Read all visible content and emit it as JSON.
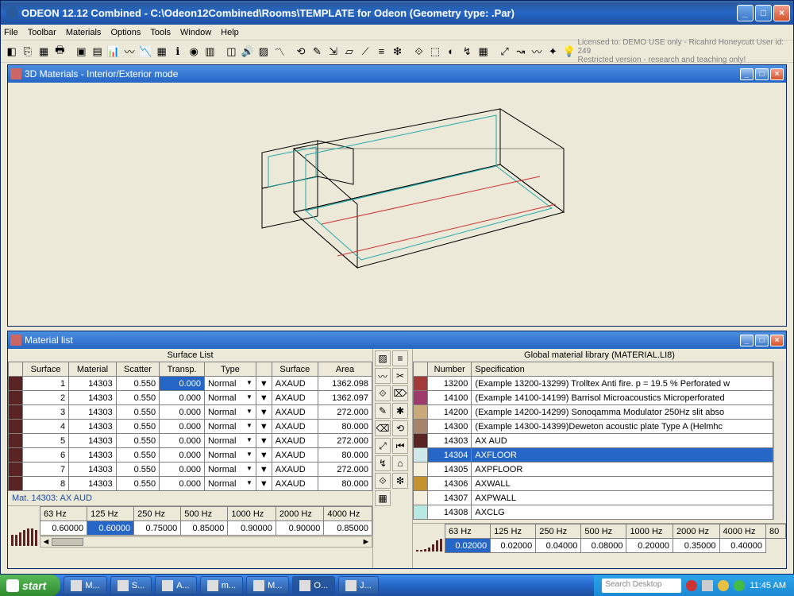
{
  "app": {
    "title": "ODEON 12.12 Combined  -  C:\\Odeon12Combined\\Rooms\\TEMPLATE for Odeon      (Geometry type: .Par)",
    "license1": "Licensed to: DEMO USE only - Ricahrd Honeycutt   User id: 249",
    "license2": "Restricted version - research and teaching only!"
  },
  "menu": [
    "File",
    "Toolbar",
    "Materials",
    "Options",
    "Tools",
    "Window",
    "Help"
  ],
  "win3d": {
    "title": "3D Materials - Interior/Exterior mode"
  },
  "winlist": {
    "title": "Material list"
  },
  "surface_list": {
    "title": "Surface List",
    "headers": [
      "",
      "Surface",
      "Material",
      "Scatter",
      "Transp.",
      "Type",
      "",
      "Surface",
      "Area"
    ],
    "rows": [
      {
        "n": "1",
        "mat": "14303",
        "sc": "0.550",
        "tr": "0.000",
        "type": "Normal",
        "surf": "AXAUD",
        "area": "1362.098",
        "sel": true
      },
      {
        "n": "2",
        "mat": "14303",
        "sc": "0.550",
        "tr": "0.000",
        "type": "Normal",
        "surf": "AXAUD",
        "area": "1362.097"
      },
      {
        "n": "3",
        "mat": "14303",
        "sc": "0.550",
        "tr": "0.000",
        "type": "Normal",
        "surf": "AXAUD",
        "area": "272.000"
      },
      {
        "n": "4",
        "mat": "14303",
        "sc": "0.550",
        "tr": "0.000",
        "type": "Normal",
        "surf": "AXAUD",
        "area": "80.000"
      },
      {
        "n": "5",
        "mat": "14303",
        "sc": "0.550",
        "tr": "0.000",
        "type": "Normal",
        "surf": "AXAUD",
        "area": "272.000"
      },
      {
        "n": "6",
        "mat": "14303",
        "sc": "0.550",
        "tr": "0.000",
        "type": "Normal",
        "surf": "AXAUD",
        "area": "80.000"
      },
      {
        "n": "7",
        "mat": "14303",
        "sc": "0.550",
        "tr": "0.000",
        "type": "Normal",
        "surf": "AXAUD",
        "area": "272.000"
      },
      {
        "n": "8",
        "mat": "14303",
        "sc": "0.550",
        "tr": "0.000",
        "type": "Normal",
        "surf": "AXAUD",
        "area": "80.000"
      }
    ]
  },
  "mat_label": "Mat. 14303: AX AUD",
  "freq": {
    "headers": [
      "63 Hz",
      "125 Hz",
      "250 Hz",
      "500 Hz",
      "1000 Hz",
      "2000 Hz",
      "4000 Hz"
    ],
    "values": [
      "0.60000",
      "0.60000",
      "0.75000",
      "0.85000",
      "0.90000",
      "0.90000",
      "0.85000"
    ]
  },
  "library": {
    "title": "Global material library (MATERIAL.LI8)",
    "headers": [
      "",
      "Number",
      "Specification"
    ],
    "rows": [
      {
        "c": "#a23a3a",
        "n": "13200",
        "s": "(Example 13200-13299) Trolltex Anti fire. p = 19.5 % Perforated w"
      },
      {
        "c": "#a03a6a",
        "n": "14100",
        "s": "(Example 14100-14199) Barrisol Microacoustics Microperforated"
      },
      {
        "c": "#caa97a",
        "n": "14200",
        "s": "(Example 14200-14299) Sonoqamma Modulator 250Hz slit abso"
      },
      {
        "c": "#a7836a",
        "n": "14300",
        "s": "(Example 14300-14399)Deweton acoustic plate Type A (Helmhc"
      },
      {
        "c": "#5a2424",
        "n": "14303",
        "s": "AX AUD"
      },
      {
        "c": "#cfe8ea",
        "n": "14304",
        "s": "AXFLOOR",
        "sel": true
      },
      {
        "c": "#f5f0dd",
        "n": "14305",
        "s": "AXPFLOOR"
      },
      {
        "c": "#c6922e",
        "n": "14306",
        "s": "AXWALL"
      },
      {
        "c": "#f5f0dd",
        "n": "14307",
        "s": "AXPWALL"
      },
      {
        "c": "#b8e8e2",
        "n": "14308",
        "s": "AXCLG"
      }
    ]
  },
  "lib_freq": {
    "headers": [
      "63 Hz",
      "125 Hz",
      "250 Hz",
      "500 Hz",
      "1000 Hz",
      "2000 Hz",
      "4000 Hz",
      "80"
    ],
    "values": [
      "0.02000",
      "0.02000",
      "0.04000",
      "0.08000",
      "0.20000",
      "0.35000",
      "0.40000"
    ]
  },
  "taskbar": {
    "start": "start",
    "items": [
      "M...",
      "S...",
      "A...",
      "m...",
      "M...",
      "O...",
      "J..."
    ],
    "search_placeholder": "Search Desktop",
    "clock": "11:45 AM"
  },
  "toolbar_icons": [
    "◧",
    "⎘",
    "▦",
    "🖶",
    "▣",
    "▤",
    "📊",
    "〰",
    "📉",
    "▦",
    "ℹ",
    "◉",
    "▥",
    "◫",
    "🔊",
    "▨",
    "〽",
    "⟲",
    "✎",
    "⇲",
    "▱",
    "⟋",
    "≡",
    "❇",
    "⟐",
    "⬚",
    "◐",
    "↯",
    "▦",
    "⤢",
    "↝",
    "〰",
    "✦",
    "💡"
  ],
  "center_icons": [
    "▨",
    "≡",
    "〰",
    "✂",
    "⟐",
    "⌦",
    "✎",
    "✱",
    "⌫",
    "⟲",
    "⤢",
    "⏮",
    "↯",
    "⌂",
    "⟐",
    "❇",
    "▦"
  ]
}
